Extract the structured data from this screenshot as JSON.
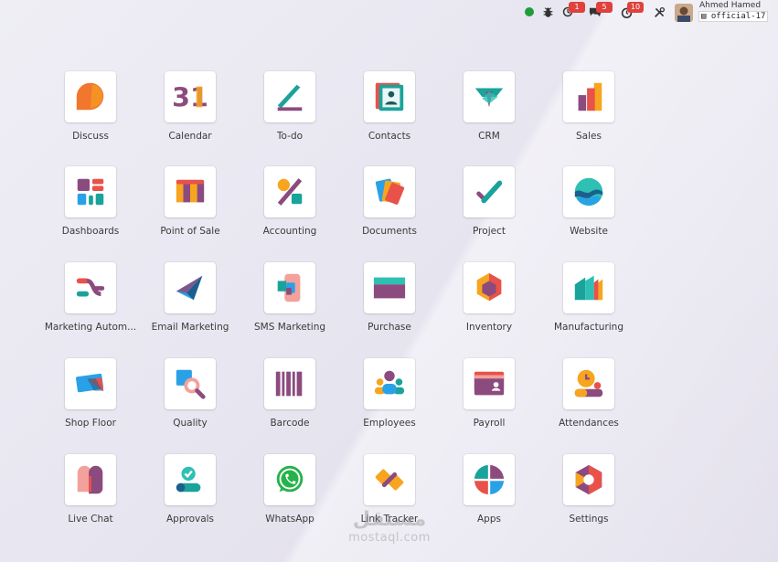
{
  "topbar": {
    "status_color": "#1f9d3a",
    "icons": [
      "status-online",
      "bug-icon",
      "activity-clock-icon",
      "chat-icon",
      "timer-icon",
      "tools-icon"
    ],
    "badges": {
      "activity": "1",
      "messages": "5",
      "timer": "10"
    },
    "user_name": "Ahmed Hamed",
    "database": "official-17"
  },
  "apps": [
    {
      "label": "Discuss",
      "icon": "discuss-icon"
    },
    {
      "label": "Calendar",
      "icon": "calendar-icon",
      "glyph": "31"
    },
    {
      "label": "To-do",
      "icon": "todo-icon"
    },
    {
      "label": "Contacts",
      "icon": "contacts-icon"
    },
    {
      "label": "CRM",
      "icon": "crm-icon"
    },
    {
      "label": "Sales",
      "icon": "sales-icon"
    },
    {
      "label": "Dashboards",
      "icon": "dashboards-icon"
    },
    {
      "label": "Point of Sale",
      "icon": "point-of-sale-icon"
    },
    {
      "label": "Accounting",
      "icon": "accounting-icon"
    },
    {
      "label": "Documents",
      "icon": "documents-icon"
    },
    {
      "label": "Project",
      "icon": "project-icon"
    },
    {
      "label": "Website",
      "icon": "website-icon"
    },
    {
      "label": "Marketing Autom...",
      "icon": "marketing-automation-icon"
    },
    {
      "label": "Email Marketing",
      "icon": "email-marketing-icon"
    },
    {
      "label": "SMS Marketing",
      "icon": "sms-marketing-icon"
    },
    {
      "label": "Purchase",
      "icon": "purchase-icon"
    },
    {
      "label": "Inventory",
      "icon": "inventory-icon"
    },
    {
      "label": "Manufacturing",
      "icon": "manufacturing-icon"
    },
    {
      "label": "Shop Floor",
      "icon": "shop-floor-icon"
    },
    {
      "label": "Quality",
      "icon": "quality-icon"
    },
    {
      "label": "Barcode",
      "icon": "barcode-icon"
    },
    {
      "label": "Employees",
      "icon": "employees-icon"
    },
    {
      "label": "Payroll",
      "icon": "payroll-icon"
    },
    {
      "label": "Attendances",
      "icon": "attendances-icon"
    },
    {
      "label": "Live Chat",
      "icon": "live-chat-icon"
    },
    {
      "label": "Approvals",
      "icon": "approvals-icon"
    },
    {
      "label": "WhatsApp",
      "icon": "whatsapp-icon"
    },
    {
      "label": "Link Tracker",
      "icon": "link-tracker-icon"
    },
    {
      "label": "Apps",
      "icon": "apps-icon"
    },
    {
      "label": "Settings",
      "icon": "settings-icon"
    }
  ],
  "watermark": {
    "arabic": "مستقل",
    "latin": "mostaql.com"
  },
  "colors": {
    "purple": "#8c4b7e",
    "teal": "#1aa39a",
    "orange": "#f7a51f",
    "red": "#e8524a",
    "blue": "#2aa1e6"
  }
}
